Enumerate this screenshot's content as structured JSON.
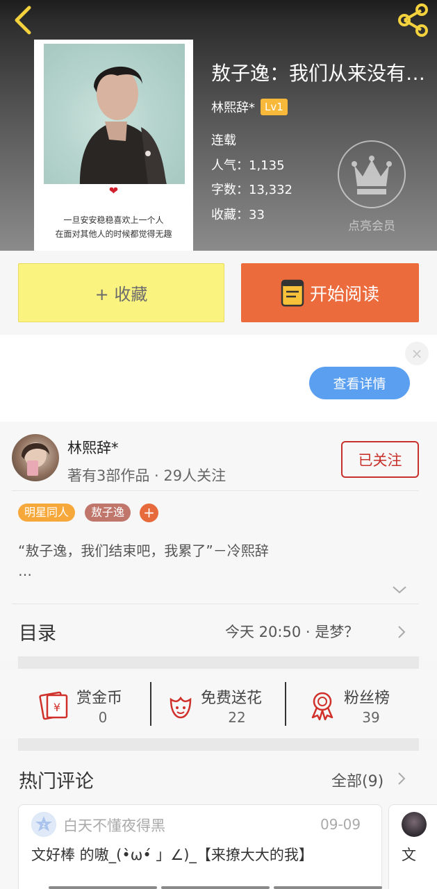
{
  "header": {
    "back_icon": "back-chevron-icon",
    "share_icon": "share-icon",
    "title": "敖子逸：我们从来没有在一起过",
    "author": "林熙辞*",
    "level": "Lv1",
    "status": "连载",
    "popularity": "人气：1,135",
    "word_count": "字数：13,332",
    "favorites": "收藏：33",
    "vip_icon": "crown-icon",
    "vip_label": "点亮会员",
    "cover": {
      "heart": "❤",
      "line1": "一旦安安稳稳喜欢上一个人",
      "line2": "在面对其他人的时候都觉得无趣"
    }
  },
  "actions": {
    "collect_label": "+ 收藏",
    "read_label": "开始阅读",
    "read_icon": "book-icon",
    "collect_color": "#fbf37f",
    "read_color": "#ec6b3c"
  },
  "ad": {
    "close_label": "×",
    "detail_label": "查看详情"
  },
  "author_section": {
    "name": "林熙辞*",
    "meta": "著有3部作品 · 29人关注",
    "follow_label": "已关注",
    "tags": [
      {
        "label": "明星同人",
        "color": "#f7a83b"
      },
      {
        "label": "敖子逸",
        "color": "#c0766b"
      }
    ],
    "tag_add": "+",
    "description": "“敖子逸，我们结束吧，我累了”－冷熙辞",
    "description_more": "…",
    "toc_label": "目录",
    "latest_chapter": "今天 20:50 · 是梦？"
  },
  "rewards": [
    {
      "label": "赏金币",
      "count": "0",
      "icon": "red-envelope-icon"
    },
    {
      "label": "免费送花",
      "count": "22",
      "icon": "flower-icon"
    },
    {
      "label": "粉丝榜",
      "count": "39",
      "icon": "medal-icon"
    }
  ],
  "comments": {
    "title": "热门评论",
    "all_label": "全部(9)",
    "items": [
      {
        "user": "白天不懂夜得黑",
        "date": "09-09",
        "text": "文好棒 的嗷_(•̀ω•́ 」∠)_【来撩大大的我】"
      },
      {
        "user": "",
        "date": "",
        "text": "文"
      }
    ]
  }
}
